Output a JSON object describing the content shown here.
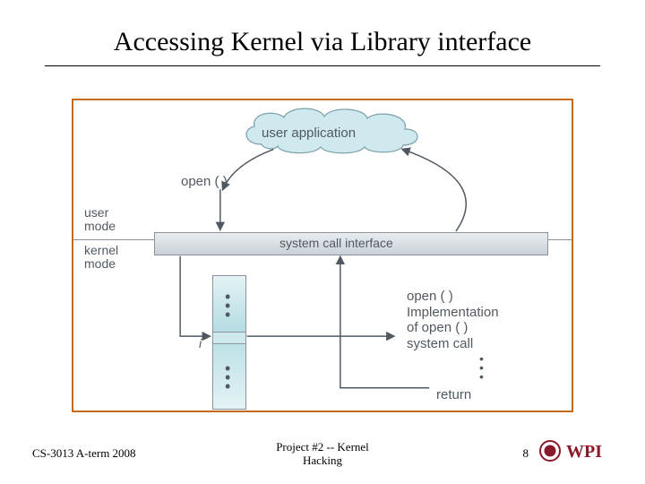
{
  "title": "Accessing Kernel via Library interface",
  "diagram": {
    "cloud_label": "user application",
    "open_top": "open ( )",
    "open_bottom": "open ( )",
    "user_mode": "user\nmode",
    "kernel_mode": "kernel\nmode",
    "sci_label": "system call interface",
    "i_label": "i",
    "impl_lines": "Implementation\nof open ( )\nsystem call",
    "return_label": "return"
  },
  "footer": {
    "left": "CS-3013 A-term 2008",
    "center": "Project #2 -- Kernel\nHacking",
    "page": "8",
    "logo_text": "WPI"
  }
}
